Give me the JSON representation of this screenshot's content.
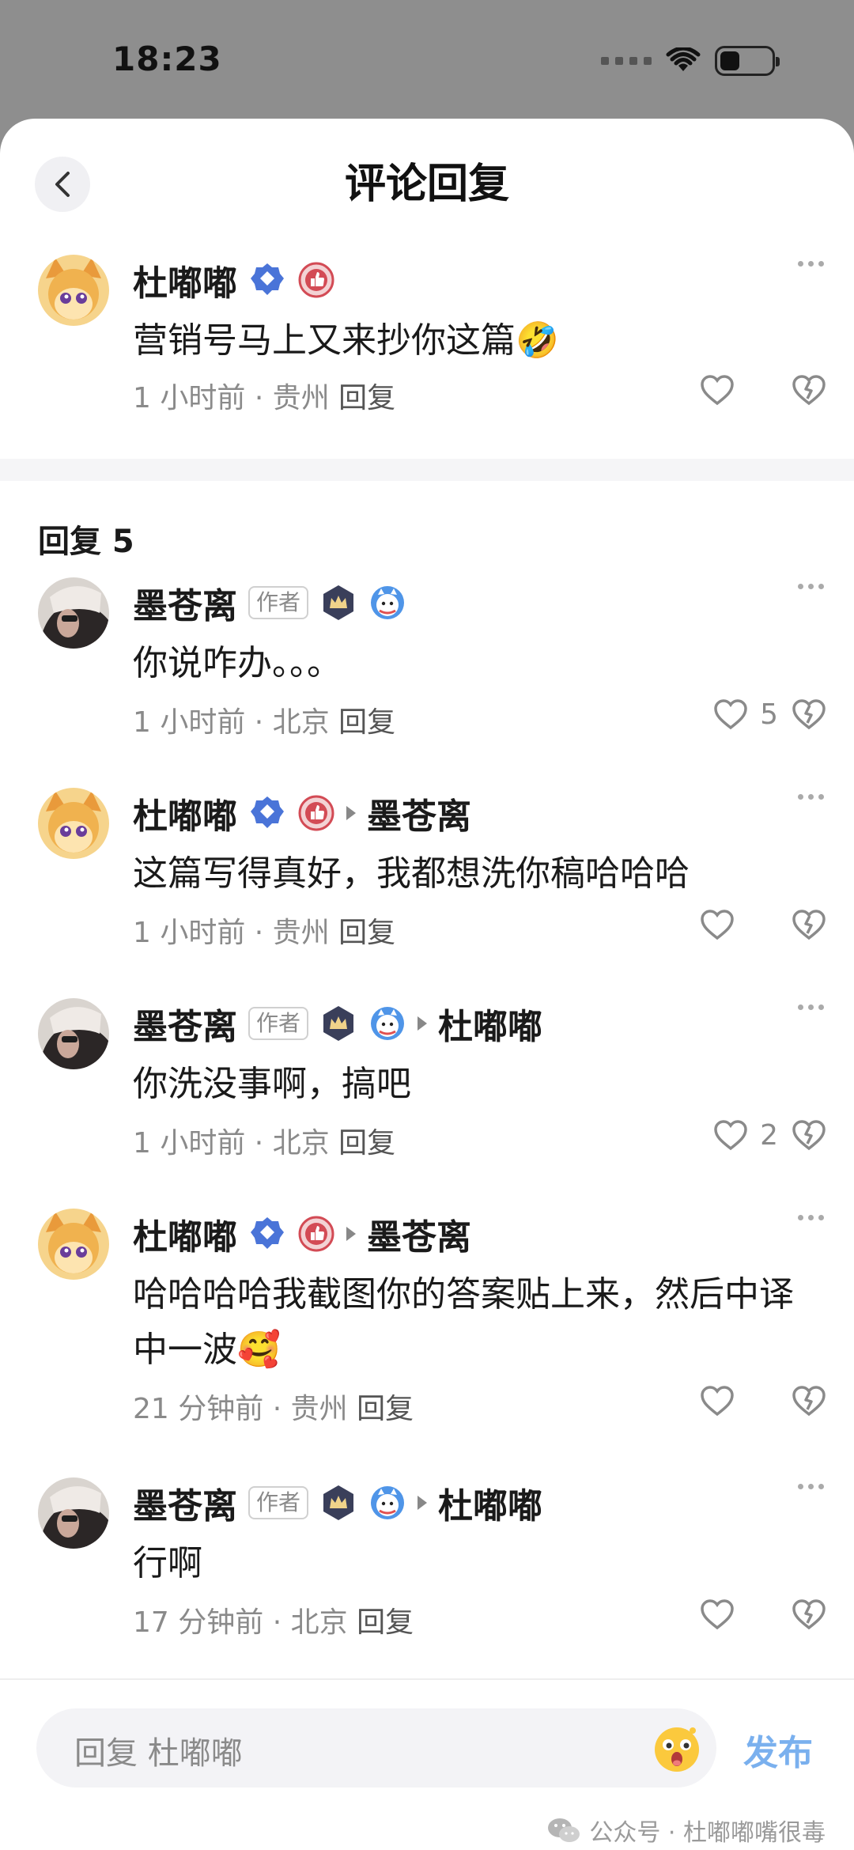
{
  "status_bar": {
    "time": "18:23"
  },
  "header": {
    "title": "评论回复"
  },
  "main_comment": {
    "username": "杜嘟嘟",
    "content": "营销号马上又来抄你这篇🤣",
    "time": "1 小时前",
    "location": "贵州",
    "reply_label": "回复"
  },
  "replies_header": {
    "label": "回复 5"
  },
  "replies": [
    {
      "username": "墨苍离",
      "author_tag": "作者",
      "reply_to": "",
      "content": "你说咋办。。。",
      "time": "1 小时前",
      "location": "北京",
      "reply_label": "回复",
      "likes": "5"
    },
    {
      "username": "杜嘟嘟",
      "author_tag": "",
      "reply_to": "墨苍离",
      "content": "这篇写得真好，我都想洗你稿哈哈哈",
      "time": "1 小时前",
      "location": "贵州",
      "reply_label": "回复",
      "likes": ""
    },
    {
      "username": "墨苍离",
      "author_tag": "作者",
      "reply_to": "杜嘟嘟",
      "content": "你洗没事啊，搞吧",
      "time": "1 小时前",
      "location": "北京",
      "reply_label": "回复",
      "likes": "2"
    },
    {
      "username": "杜嘟嘟",
      "author_tag": "",
      "reply_to": "墨苍离",
      "content": "哈哈哈哈我截图你的答案贴上来，然后中译中一波🥰",
      "time": "21 分钟前",
      "location": "贵州",
      "reply_label": "回复",
      "likes": ""
    },
    {
      "username": "墨苍离",
      "author_tag": "作者",
      "reply_to": "杜嘟嘟",
      "content": "行啊",
      "time": "17 分钟前",
      "location": "北京",
      "reply_label": "回复",
      "likes": ""
    }
  ],
  "composer": {
    "placeholder": "回复 杜嘟嘟",
    "publish_label": "发布"
  },
  "watermark": {
    "text": "公众号 · 杜嘟嘟嘴很毒"
  },
  "colors": {
    "accent": "#7ab0ee",
    "muted": "#8a8a8a",
    "divider": "#f5f5f7"
  },
  "icons": [
    "back-icon",
    "verified-icon",
    "like-badge-icon",
    "crown-badge-icon",
    "mascot-badge-icon",
    "more-icon",
    "heart-icon",
    "dislike-icon",
    "emoji-icon",
    "wechat-icon"
  ]
}
